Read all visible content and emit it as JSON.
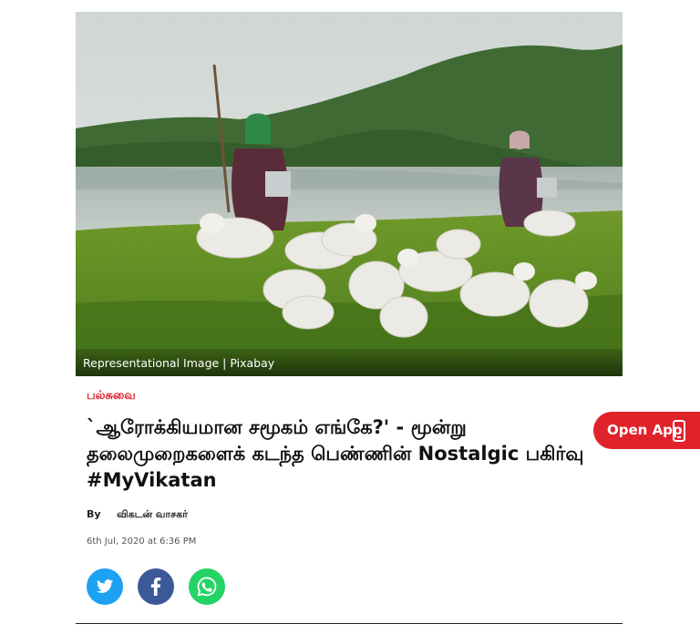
{
  "hero": {
    "caption": "Representational Image | Pixabay"
  },
  "article": {
    "section": "பல்சுவை",
    "title": "`ஆரோக்கியமான சமூகம் எங்கே?' - மூன்று தலைமுறைகளைக் கடந்த பெண்ணின் Nostalgic பகிர்வு #MyVikatan",
    "by_label": "By",
    "author": "விகடன் வாசகர்",
    "date": "6th Jul, 2020 at 6:36 PM"
  },
  "share": {
    "twitter_icon": "twitter-icon",
    "facebook_icon": "facebook-icon",
    "whatsapp_icon": "whatsapp-icon"
  },
  "open_app": {
    "label": "Open App",
    "icon": "phone-icon"
  },
  "colors": {
    "accent": "#e0232b",
    "twitter": "#1da1f2",
    "facebook": "#3b5998",
    "whatsapp": "#25d366"
  }
}
